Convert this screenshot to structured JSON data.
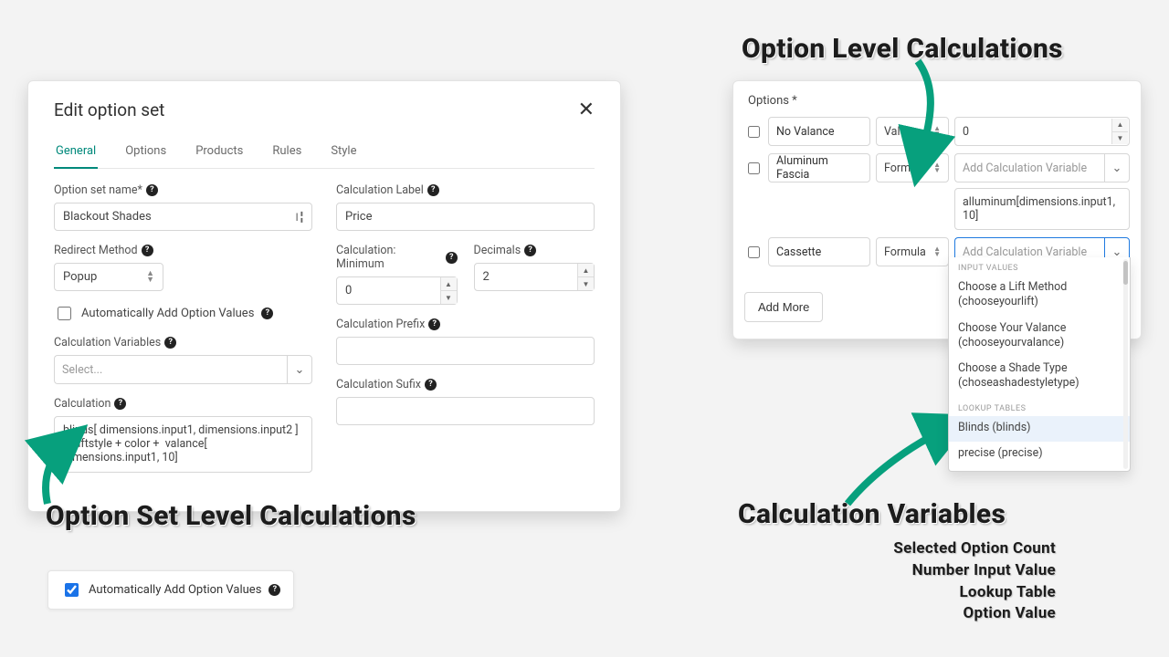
{
  "left": {
    "title": "Edit option set",
    "tabs": [
      "General",
      "Options",
      "Products",
      "Rules",
      "Style"
    ],
    "activeTab": "General",
    "fields": {
      "optionSetName": {
        "label": "Option set name*",
        "value": "Blackout Shades"
      },
      "redirectMethod": {
        "label": "Redirect Method",
        "value": "Popup"
      },
      "autoAdd": {
        "label": "Automatically Add Option Values"
      },
      "calcVars": {
        "label": "Calculation Variables",
        "placeholder": "Select..."
      },
      "calculation": {
        "label": "Calculation",
        "value": "blinds[ dimensions.input1, dimensions.input2 ]   +  liftstyle + color +  valance[  dimensions.input1, 10]"
      },
      "calcLabel": {
        "label": "Calculation Label",
        "value": "Price"
      },
      "calcMin": {
        "label": "Calculation: Minimum",
        "value": "0"
      },
      "decimals": {
        "label": "Decimals",
        "value": "2"
      },
      "calcPrefix": {
        "label": "Calculation Prefix",
        "value": ""
      },
      "calcSuffix": {
        "label": "Calculation Sufix",
        "value": ""
      }
    }
  },
  "autoChip": {
    "label": "Automatically Add Option Values"
  },
  "right": {
    "title": "Options *",
    "rows": [
      {
        "name": "No Valance",
        "type": "Value",
        "numeric": "0"
      },
      {
        "name": "Aluminum Fascia",
        "type": "Formula",
        "placeholder": "Add Calculation Variable",
        "result": "alluminum[dimensions.input1, 10]"
      },
      {
        "name": "Cassette",
        "type": "Formula",
        "placeholder": "Add Calculation Variable"
      }
    ],
    "addMore": "Add More"
  },
  "dropdown": {
    "groups": [
      {
        "label": "INPUT VALUES",
        "items": [
          "Choose a Lift Method (chooseyourlift)",
          "Choose Your Valance (chooseyourvalance)",
          "Choose a Shade Type (choseashadestyletype)"
        ]
      },
      {
        "label": "LOOKUP TABLES",
        "items": [
          "Blinds (blinds)",
          "precise (precise)"
        ],
        "highlight": 0
      }
    ]
  },
  "annotations": {
    "optionLevel": "Option Level Calculations",
    "optionSetLevel": "Option Set Level Calculations",
    "calcVars": "Calculation Variables",
    "subs": [
      "Selected Option Count",
      "Number Input Value",
      "Lookup Table",
      "Option Value"
    ]
  },
  "colors": {
    "accent": "#00897b",
    "arrow": "#07a07d"
  }
}
